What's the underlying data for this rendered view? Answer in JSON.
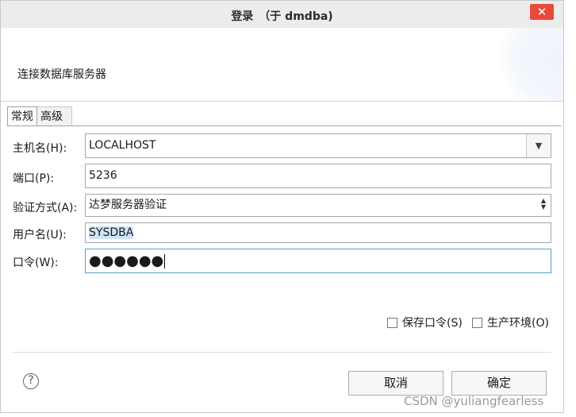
{
  "window": {
    "title": "登录　（于 dmdba)",
    "close_glyph": "✕",
    "header_text": "连接数据库服务器"
  },
  "tabs": [
    {
      "label": "常规",
      "active": true
    },
    {
      "label": "高级",
      "active": false
    }
  ],
  "form": {
    "host": {
      "label": "主机名(H):",
      "value": "LOCALHOST"
    },
    "port": {
      "label": "端口(P):",
      "value": "5236"
    },
    "auth": {
      "label": "验证方式(A):",
      "value": "达梦服务器验证"
    },
    "user": {
      "label": "用户名(U):",
      "value": "SYSDBA"
    },
    "password": {
      "label": "口令(W):",
      "value": "●●●●●●"
    }
  },
  "options": {
    "save_password": {
      "label": "保存口令(S)",
      "checked": false
    },
    "production_env": {
      "label": "生产环境(O)",
      "checked": false
    }
  },
  "buttons": {
    "help": "?",
    "cancel": "取消",
    "ok": "确定"
  },
  "watermark": "CSDN @yuliangfearless",
  "icons": {
    "combo_arrow": "▼",
    "spin_up": "▲",
    "spin_down": "▼"
  },
  "colors": {
    "close_button": "#e84a3c",
    "selection": "#cfe3f7",
    "focus_border": "#5aa0c8"
  }
}
